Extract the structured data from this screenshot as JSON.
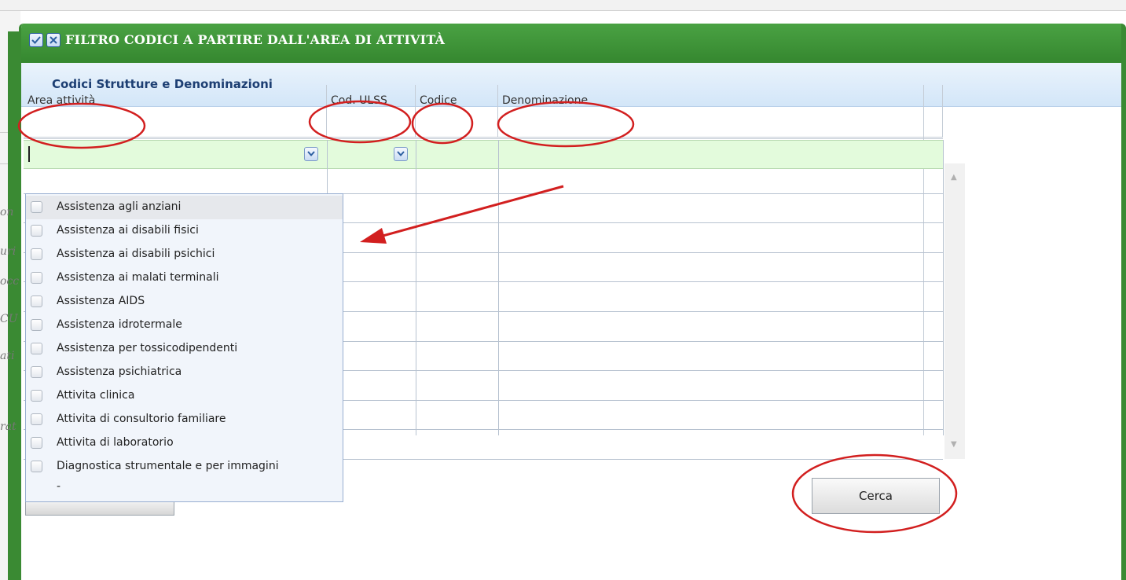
{
  "dialog": {
    "title": "FILTRO CODICI A PARTIRE DALL'AREA DI ATTIVITÀ",
    "subheader": "Codici Strutture e Denominazioni"
  },
  "grid": {
    "columns": [
      "Area attività",
      "Cod. ULSS",
      "Codice",
      "Denominazione"
    ],
    "filter": {
      "area_value": "",
      "ulss_value": ""
    }
  },
  "dropdown": {
    "options": [
      "Assistenza agli anziani",
      "Assistenza ai disabili fisici",
      "Assistenza ai disabili psichici",
      "Assistenza ai malati terminali",
      "Assistenza AIDS",
      "Assistenza idrotermale",
      "Assistenza per tossicodipendenti",
      "Assistenza psichiatrica",
      "Attivita clinica",
      "Attivita di consultorio familiare",
      "Attivita di laboratorio",
      "Diagnostica strumentale e per immagini"
    ],
    "trailing_text": "-"
  },
  "actions": {
    "search_label": "Cerca"
  },
  "background": {
    "fragments": [
      "on",
      "uri",
      "occ",
      "CU",
      "ati",
      "rat"
    ]
  },
  "colors": {
    "title_green": "#3a8a33",
    "filter_row": "#e3fbdc",
    "annotation_red": "#d21f1f"
  },
  "icons": {
    "title_check": "check-icon",
    "title_close": "close-icon",
    "combo": "chevron-down-icon"
  }
}
